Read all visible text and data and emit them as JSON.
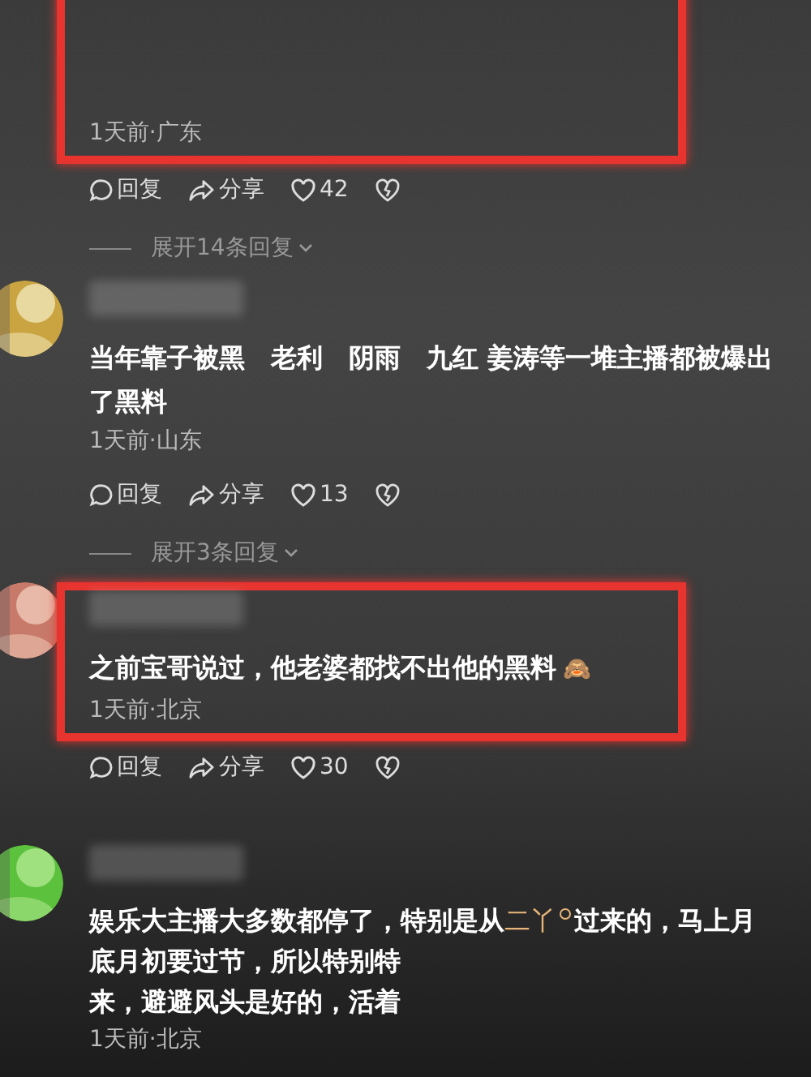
{
  "comments": [
    {
      "highlighted": true,
      "date": "1天前·广东",
      "actions": {
        "reply": "回复",
        "share": "分享",
        "likes": "42"
      },
      "expand": "展开14条回复"
    },
    {
      "highlighted": false,
      "avatar": {
        "kind": "picture"
      },
      "lines": [
        [
          {
            "kind": "plain",
            "text": "当年靠子被黑　老利　阴雨　九红  姜涛等一堆主播都被爆出"
          }
        ],
        [
          {
            "kind": "plain",
            "text": "了黑料"
          }
        ]
      ],
      "date": "1天前·山东",
      "actions": {
        "reply": "回复",
        "share": "分享",
        "likes": "13"
      },
      "expand": "展开3条回复"
    },
    {
      "highlighted": true,
      "avatar": {
        "kind": "picture"
      },
      "lines": [
        [
          {
            "kind": "plain",
            "text": "之前宝哥说过，他老婆都找不出他的黑料"
          },
          {
            "kind": "emoji",
            "text": "🙈"
          }
        ]
      ],
      "date": "1天前·北京",
      "actions": {
        "reply": "回复",
        "share": "分享",
        "likes": "30"
      }
    },
    {
      "highlighted": false,
      "avatar": {
        "kind": "picture"
      },
      "lines": [
        [
          {
            "kind": "plain",
            "text": "娱乐大主播大多数都停了，特别是从"
          },
          {
            "kind": "topic",
            "text": "二丫"
          },
          {
            "kind": "plain",
            "text": "过来的，马上月"
          }
        ],
        [
          {
            "kind": "plain",
            "text": "底月初要过节，所以特别特"
          }
        ],
        [
          {
            "kind": "plain",
            "text": "来，避避风头是好的，活着"
          }
        ]
      ],
      "date": "1天前·北京"
    }
  ]
}
